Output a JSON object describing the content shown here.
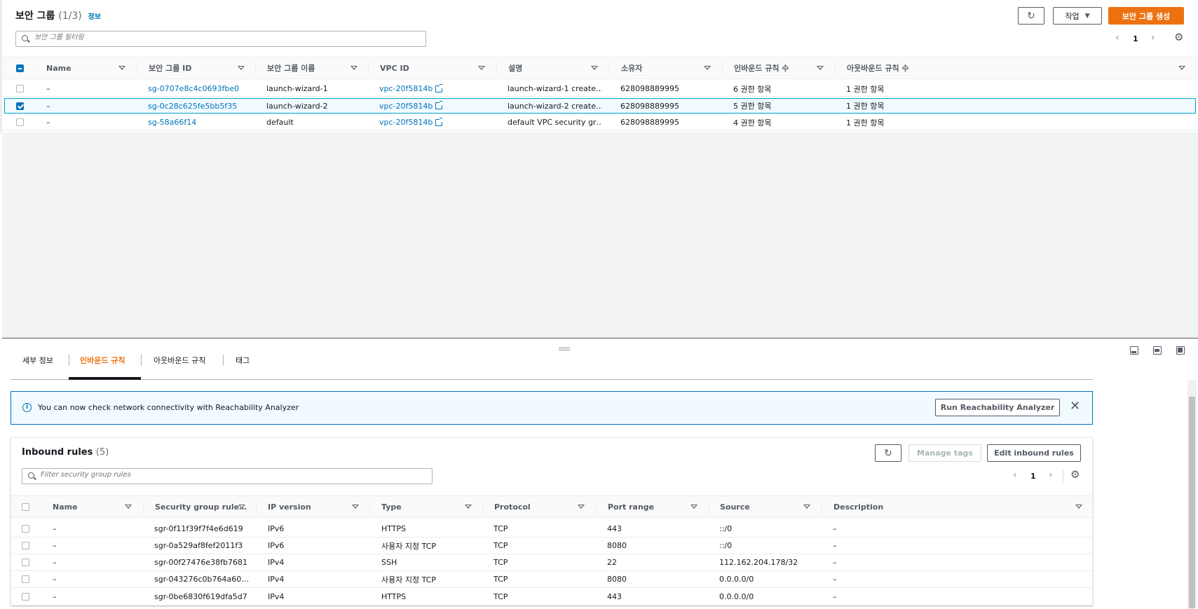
{
  "top": {
    "title": "보안 그룹",
    "count": "(1/3)",
    "info": "정보",
    "actions_label": "작업",
    "create_label": "보안 그룹 생성",
    "search_placeholder": "보안 그룹 필터링",
    "page": "1",
    "columns": [
      "Name",
      "보안 그룹 ID",
      "보안 그룹 이름",
      "VPC ID",
      "설명",
      "소유자",
      "인바운드 규칙 수",
      "아웃바운드 규칙 수"
    ],
    "rows": [
      {
        "name": "–",
        "id": "sg-0707e8c4c0693fbe0",
        "group_name": "launch-wizard-1",
        "vpc": "vpc-20f5814b",
        "desc": "launch-wizard-1 create…",
        "owner": "628098889995",
        "inbound": "6 권한 항목",
        "outbound": "1 권한 항목"
      },
      {
        "name": "–",
        "id": "sg-0c28c625fe5bb5f35",
        "group_name": "launch-wizard-2",
        "vpc": "vpc-20f5814b",
        "desc": "launch-wizard-2 create…",
        "owner": "628098889995",
        "inbound": "5 권한 항목",
        "outbound": "1 권한 항목"
      },
      {
        "name": "–",
        "id": "sg-58a66f14",
        "group_name": "default",
        "vpc": "vpc-20f5814b",
        "desc": "default VPC security gr…",
        "owner": "628098889995",
        "inbound": "4 권한 항목",
        "outbound": "1 권한 항목"
      }
    ]
  },
  "tabs": [
    "세부 정보",
    "인바운드 규칙",
    "아웃바운드 규칙",
    "태그"
  ],
  "banner": {
    "text": "You can now check network connectivity with Reachability Analyzer",
    "button": "Run Reachability Analyzer"
  },
  "inbound": {
    "title": "Inbound rules",
    "count": "(5)",
    "manage_tags": "Manage tags",
    "edit": "Edit inbound rules",
    "search_placeholder": "Filter security group rules",
    "page": "1",
    "columns": [
      "Name",
      "Security group rule…",
      "IP version",
      "Type",
      "Protocol",
      "Port range",
      "Source",
      "Description"
    ],
    "rows": [
      {
        "name": "–",
        "rule": "sgr-0f11f39f7f4e6d619",
        "ip": "IPv6",
        "type": "HTTPS",
        "proto": "TCP",
        "port": "443",
        "source": "::/0",
        "desc": "–"
      },
      {
        "name": "–",
        "rule": "sgr-0a529af8fef2011f3",
        "ip": "IPv6",
        "type": "사용자 지정 TCP",
        "proto": "TCP",
        "port": "8080",
        "source": "::/0",
        "desc": "–"
      },
      {
        "name": "–",
        "rule": "sgr-00f27476e38fb7681",
        "ip": "IPv4",
        "type": "SSH",
        "proto": "TCP",
        "port": "22",
        "source": "112.162.204.178/32",
        "desc": "–"
      },
      {
        "name": "–",
        "rule": "sgr-043276c0b764a60…",
        "ip": "IPv4",
        "type": "사용자 지정 TCP",
        "proto": "TCP",
        "port": "8080",
        "source": "0.0.0.0/0",
        "desc": "–"
      },
      {
        "name": "–",
        "rule": "sgr-0be6830f619dfa5d7",
        "ip": "IPv4",
        "type": "HTTPS",
        "proto": "TCP",
        "port": "443",
        "source": "0.0.0.0/0",
        "desc": "–"
      }
    ]
  }
}
